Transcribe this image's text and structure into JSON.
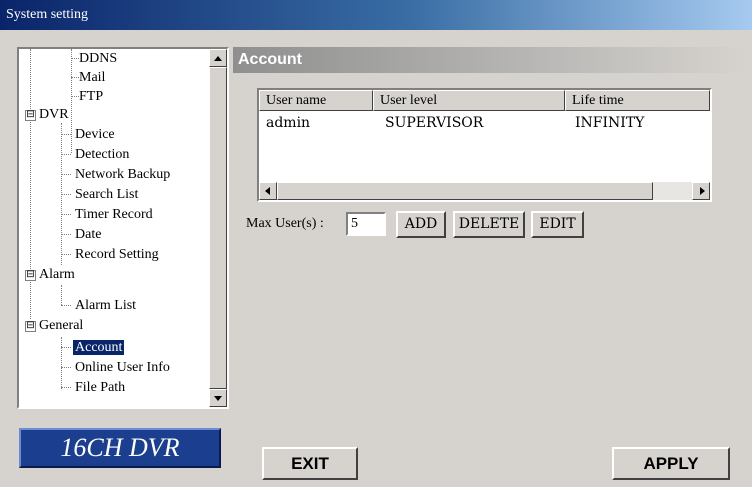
{
  "window": {
    "title": "System setting"
  },
  "tree": {
    "items": [
      {
        "label": "DDNS"
      },
      {
        "label": "Mail"
      },
      {
        "label": "FTP"
      },
      {
        "label": "DVR",
        "expander": "⊟"
      },
      {
        "label": "Device"
      },
      {
        "label": "Detection"
      },
      {
        "label": "Network Backup"
      },
      {
        "label": "Search List"
      },
      {
        "label": "Timer Record"
      },
      {
        "label": "Date"
      },
      {
        "label": "Record Setting"
      },
      {
        "label": "Alarm",
        "expander": "⊟"
      },
      {
        "label": "Alarm List"
      },
      {
        "label": "General",
        "expander": "⊟"
      },
      {
        "label": "Account",
        "selected": true
      },
      {
        "label": "Online User Info"
      },
      {
        "label": "File Path"
      }
    ]
  },
  "logo": {
    "text": "16CH DVR"
  },
  "account": {
    "title": "Account",
    "columns": [
      "User name",
      "User level",
      "Life time"
    ],
    "rows": [
      {
        "name": "admin",
        "level": "SUPERVISOR",
        "life": "INFINITY"
      }
    ],
    "max_users_label": "Max User(s) :",
    "max_users_value": "5",
    "add_label": "ADD",
    "delete_label": "DELETE",
    "edit_label": "EDIT"
  },
  "footer": {
    "exit_label": "EXIT",
    "apply_label": "APPLY"
  },
  "colors": {
    "titlebar": "#0a246a",
    "selection": "#0a246a",
    "logo_bg": "#1b3f8e",
    "face": "#d6d3ce"
  }
}
